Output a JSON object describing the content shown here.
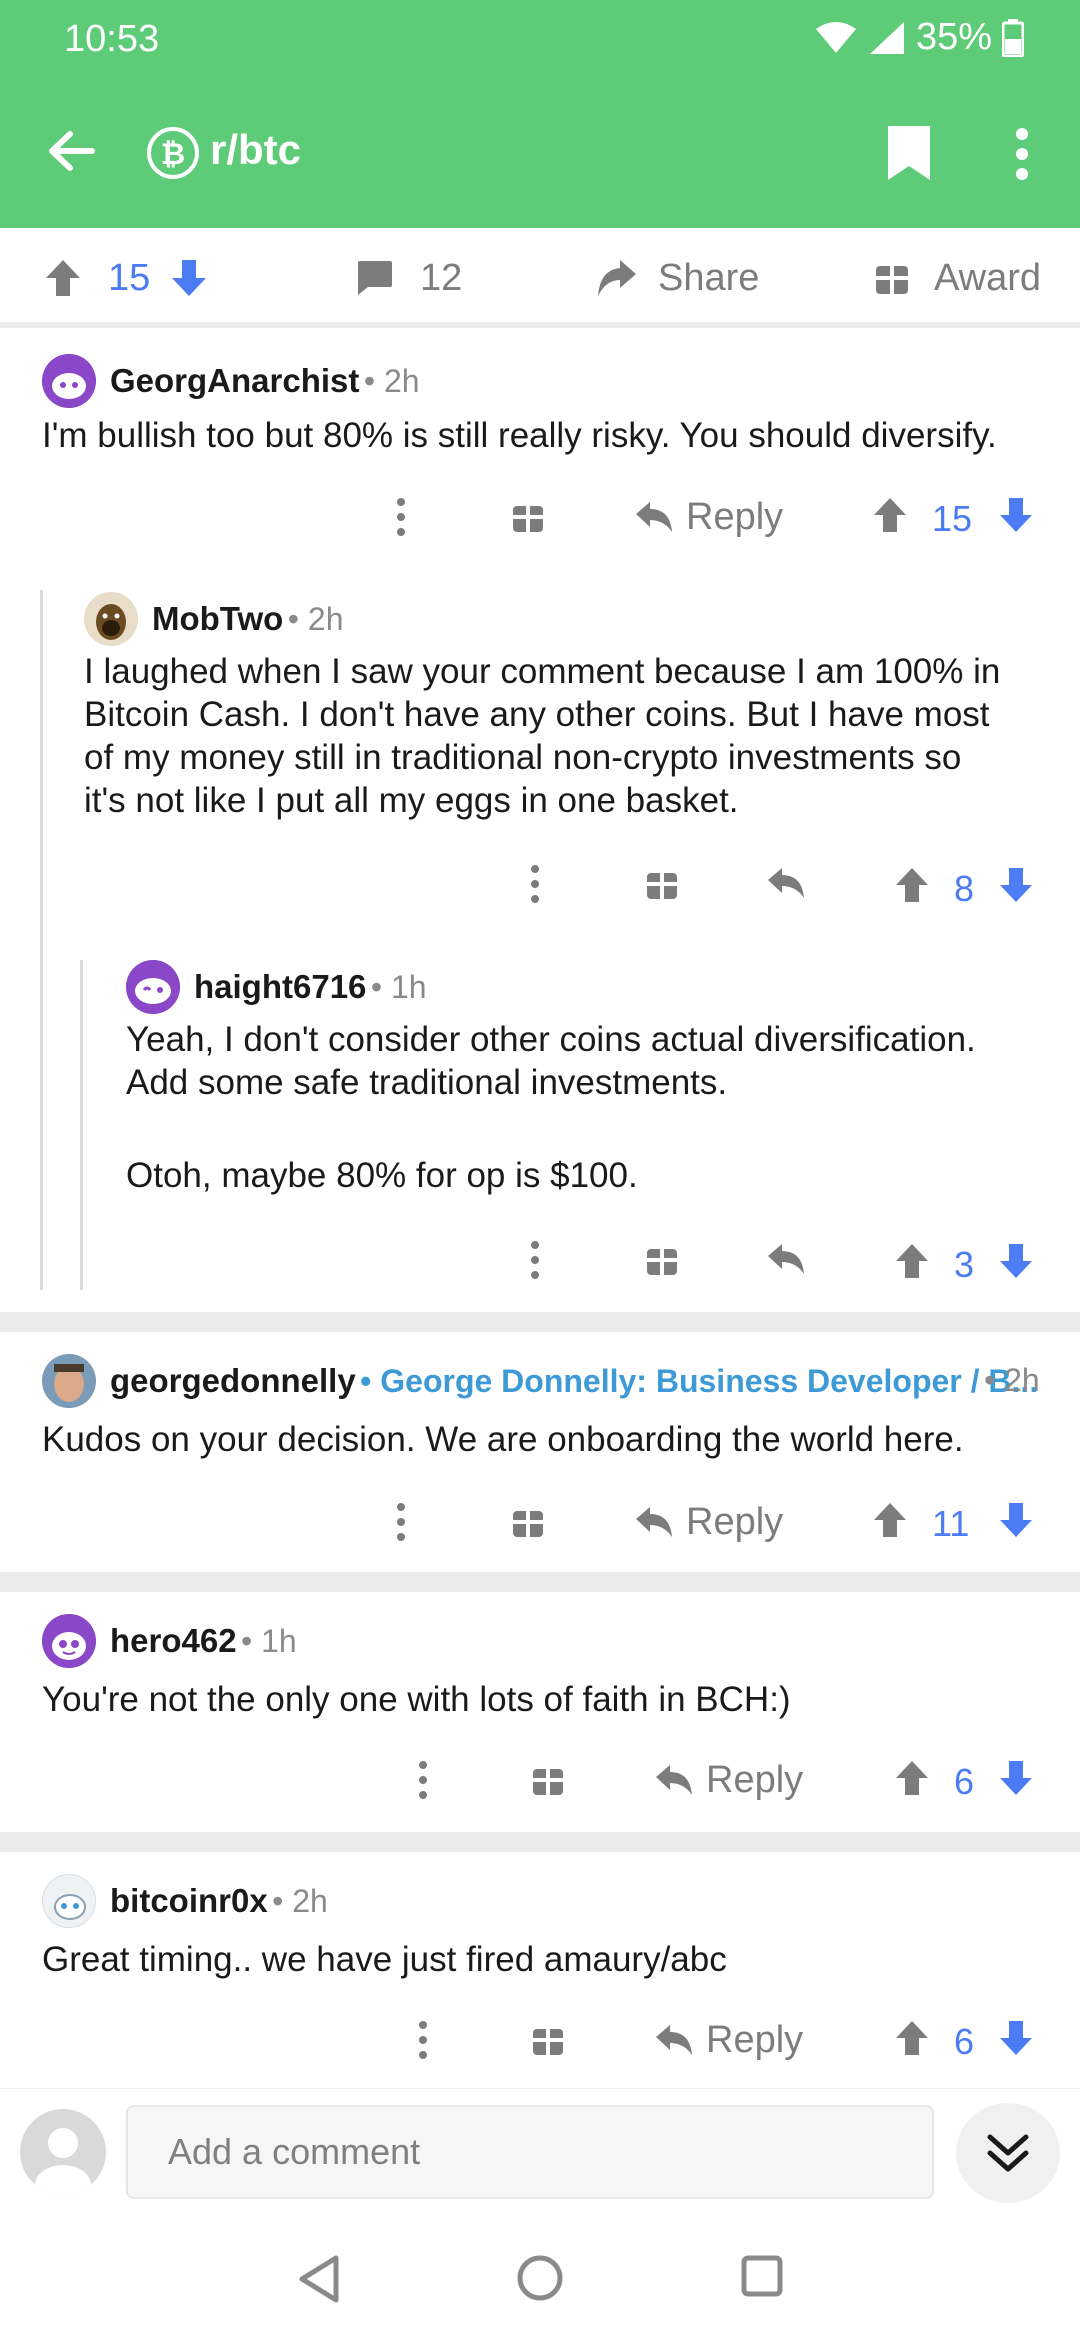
{
  "status_bar": {
    "time": "10:53",
    "battery": "35%"
  },
  "toolbar": {
    "title": "r/btc",
    "icons": [
      "back-arrow-icon",
      "bitcoin-icon",
      "bookmark-icon",
      "more-vert-icon"
    ]
  },
  "post_actions": {
    "score": "15",
    "comments": "12",
    "share_label": "Share",
    "award_label": "Award"
  },
  "comments": [
    {
      "user": "GeorgAnarchist",
      "time": "• 2h",
      "text": "I'm bullish too but 80% is still really risky. You should diversify.",
      "reply_label": "Reply",
      "score": "15"
    },
    {
      "user": "MobTwo",
      "time": "• 2h",
      "lines": [
        "I laughed when I saw your comment because I am 100% in",
        "Bitcoin Cash. I don't have any other coins. But I have most",
        "of my money still in traditional non-crypto investments so",
        "it's not like I put all my eggs in one basket."
      ],
      "score": "8"
    },
    {
      "user": "haight6716",
      "time": "• 1h",
      "lines": [
        "Yeah, I don't consider other coins actual diversification.",
        "Add some safe traditional investments.",
        "Otoh, maybe 80% for op is $100."
      ],
      "score": "3"
    },
    {
      "user": "georgedonnelly",
      "flair": "• George Donnelly: Business Developer / B...",
      "time": "• 2h",
      "text": "Kudos on your decision. We are onboarding the world here.",
      "reply_label": "Reply",
      "score": "11"
    },
    {
      "user": "hero462",
      "time": "• 1h",
      "text": "You're not the only one with lots of faith in BCH:)",
      "reply_label": "Reply",
      "score": "6"
    },
    {
      "user": "bitcoinr0x",
      "time": "• 2h",
      "text": "Great timing.. we have just fired amaury/abc",
      "reply_label": "Reply",
      "score": "6"
    }
  ],
  "comment_input": {
    "placeholder": "Add a comment"
  },
  "colors": {
    "header": "#5ecb78",
    "upvote": "#7c7c7c",
    "downvote": "#4c7cf3",
    "flair": "#3e9ad6"
  }
}
